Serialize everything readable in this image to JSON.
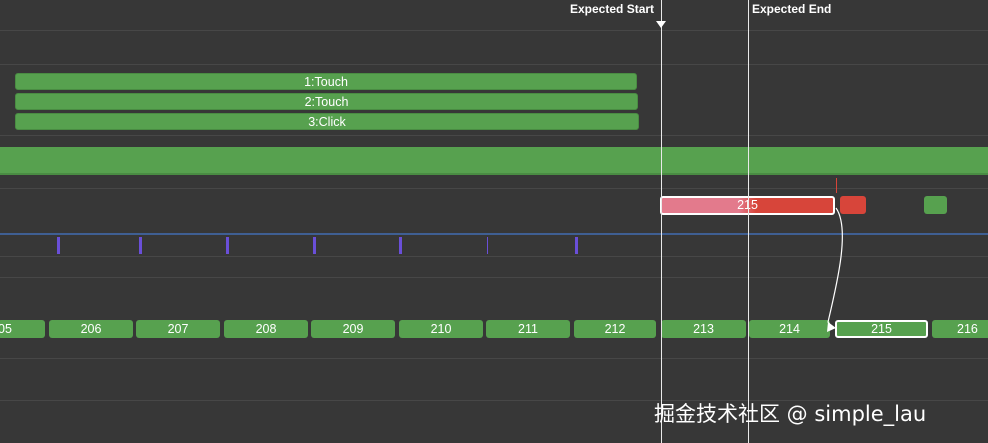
{
  "markers": {
    "expected_start": "Expected Start",
    "expected_end": "Expected End"
  },
  "input_events": [
    {
      "label": "1:Touch"
    },
    {
      "label": "2:Touch"
    },
    {
      "label": "3:Click"
    }
  ],
  "late_frame": {
    "label": "215"
  },
  "frames": [
    {
      "label": "05"
    },
    {
      "label": "206"
    },
    {
      "label": "207"
    },
    {
      "label": "208"
    },
    {
      "label": "209"
    },
    {
      "label": "210"
    },
    {
      "label": "211"
    },
    {
      "label": "212"
    },
    {
      "label": "213"
    },
    {
      "label": "214"
    },
    {
      "label": "215"
    },
    {
      "label": "216"
    }
  ],
  "colors": {
    "background": "#373737",
    "on_time_frame": "#57a14f",
    "late_frame_start": "#e37a8c",
    "late_frame_end": "#d7453a",
    "vsync_tick": "#6a4fd8",
    "marker_line": "#e9e9e9"
  },
  "watermark": "掘金技术社区 @ simple_lau"
}
